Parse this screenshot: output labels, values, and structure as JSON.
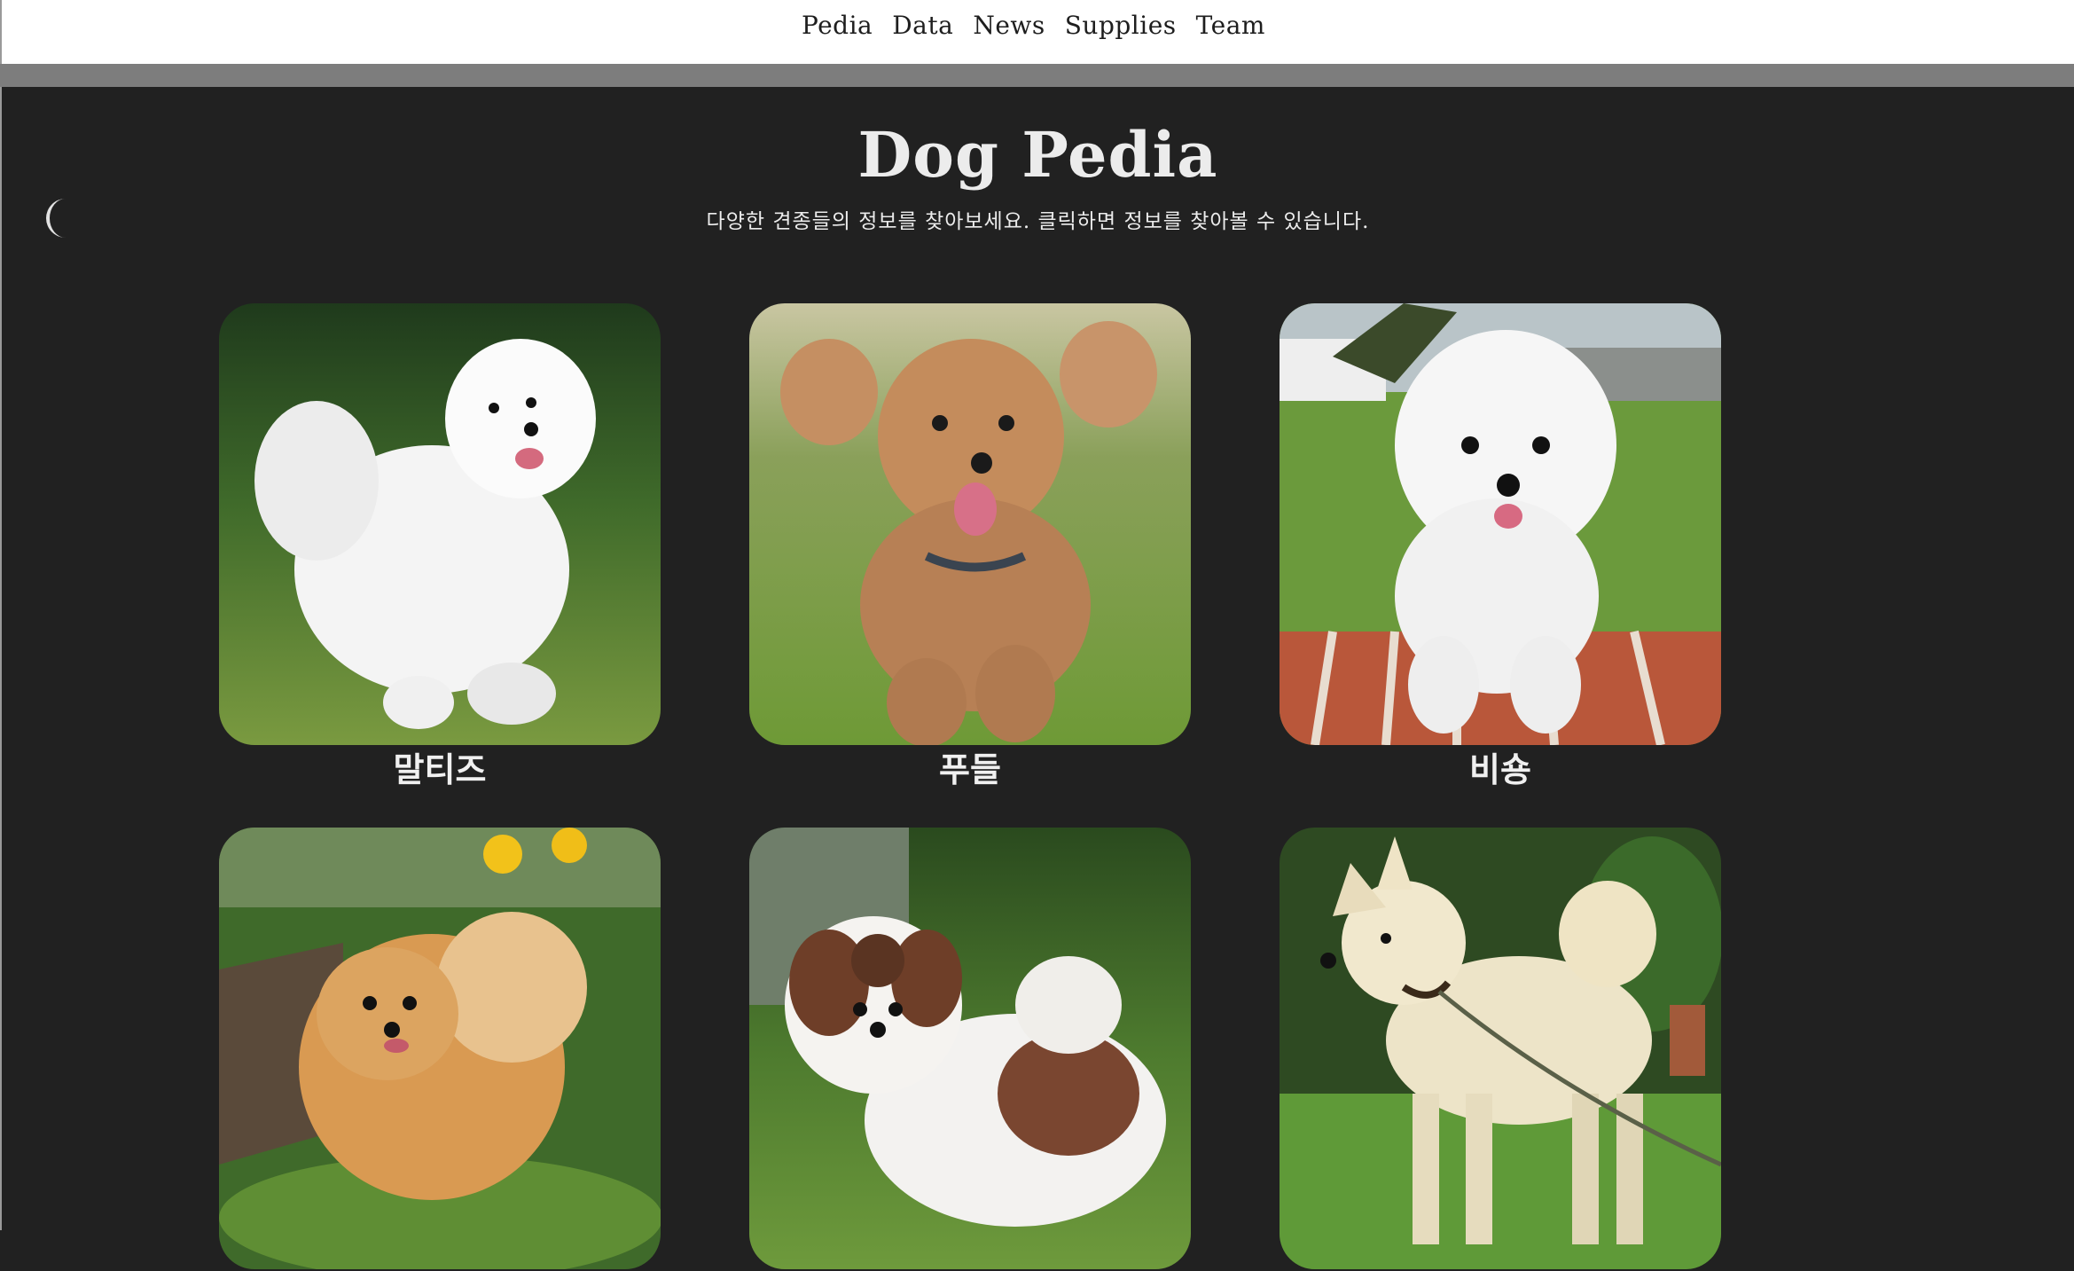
{
  "nav": {
    "items": [
      "Pedia",
      "Data",
      "News",
      "Supplies",
      "Team"
    ]
  },
  "header": {
    "title": "Dog Pedia",
    "subtitle": "다양한 견종들의 정보를 찾아보세요. 클릭하면 정보를 찾아볼 수 있습니다."
  },
  "theme_toggle": {
    "icon": "moon-icon"
  },
  "breeds": [
    {
      "name": "말티즈",
      "photo": "white maltese running on grass"
    },
    {
      "name": "푸들",
      "photo": "brown toy poodle running on grass"
    },
    {
      "name": "비숑",
      "photo": "white bichon standing on brick step"
    },
    {
      "name": "",
      "photo": "orange pomeranian in flowers"
    },
    {
      "name": "",
      "photo": "brown and white shih tzu on grass"
    },
    {
      "name": "",
      "photo": "cream jindo dog on leash"
    }
  ],
  "colors": {
    "background": "#212121",
    "topbar": "#ffffff",
    "divider": "#7d7d7d",
    "text_light": "#ececec"
  }
}
